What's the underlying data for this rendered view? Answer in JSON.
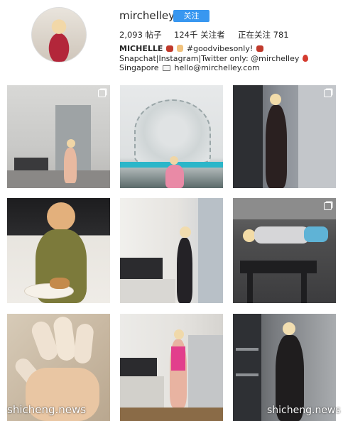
{
  "profile": {
    "username": "mirchelley",
    "follow_label": "关注",
    "stats": {
      "posts": "2,093 帖子",
      "followers": "124千 关注者",
      "following": "正在关注 781"
    },
    "bio": {
      "name": "MICHELLE",
      "line1_rest": "#goodvibesonly!",
      "line2": "Snapchat|Instagram|Twitter only: @mirchelley",
      "line3_place": "Singapore",
      "line3_email": "hello@mirchelley.com"
    }
  },
  "icons": {
    "pin": "round-pushpin-icon",
    "bag": "handbag-icon",
    "hand": "hand-icon",
    "mail": "envelope-icon",
    "multi": "multiple-photos-icon"
  },
  "watermarks": {
    "left": "shicheng.news",
    "right": "shicheng.news"
  },
  "colors": {
    "follow_button": "#3897f0",
    "text": "#262626"
  }
}
